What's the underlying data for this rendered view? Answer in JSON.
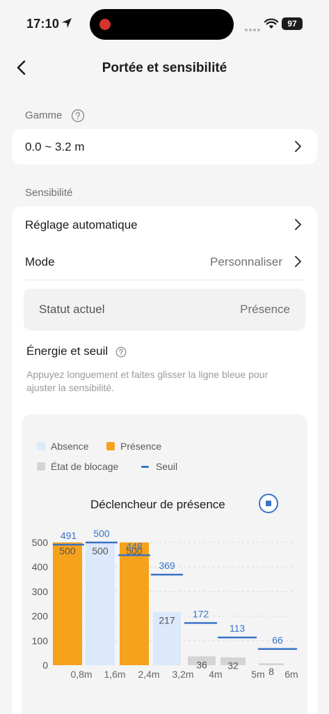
{
  "status_bar": {
    "time": "17:10",
    "battery": "97"
  },
  "header": {
    "title": "Portée et sensibilité"
  },
  "gamme": {
    "label": "Gamme",
    "value": "0.0 ~ 3.2 m"
  },
  "sensibilite": {
    "label": "Sensibilité",
    "auto_label": "Réglage automatique",
    "mode_label": "Mode",
    "mode_value": "Personnaliser",
    "status_label": "Statut actuel",
    "status_value": "Présence",
    "energy_title": "Énergie et seuil",
    "hint": "Appuyez longuement et faites glisser la ligne bleue pour ajuster la sensibilité."
  },
  "colors": {
    "presence": "#f7a21b",
    "absence": "#dce8fb",
    "blocked": "#d4d4d4",
    "threshold": "#3a73c6"
  },
  "chart_data": {
    "type": "bar",
    "title": "Déclencheur de présence",
    "legend": [
      "Absence",
      "Présence",
      "État de blocage",
      "Seuil"
    ],
    "categories": [
      "0,8m",
      "1,6m",
      "2,4m",
      "3,2m",
      "4m",
      "5m",
      "6m"
    ],
    "values": [
      500,
      500,
      500,
      217,
      36,
      32,
      8
    ],
    "states": [
      "Présence",
      "Absence",
      "Présence",
      "Absence",
      "État de blocage",
      "État de blocage",
      "État de blocage"
    ],
    "threshold": [
      491,
      500,
      448,
      369,
      172,
      113,
      66
    ],
    "y_ticks": [
      0,
      100,
      200,
      300,
      400,
      500
    ],
    "ylim": [
      0,
      560
    ],
    "grid": true
  }
}
